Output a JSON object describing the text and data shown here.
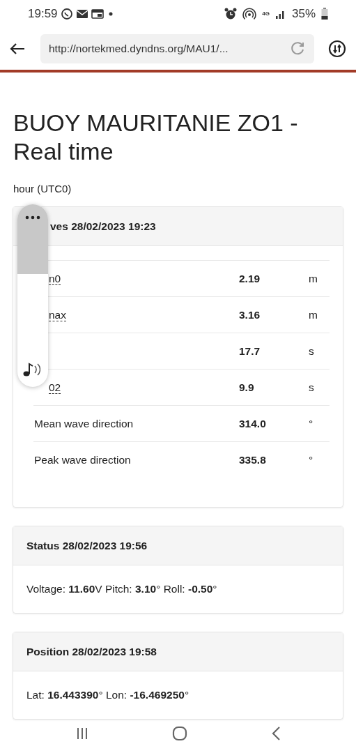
{
  "status_bar": {
    "time": "19:59",
    "network": "4G",
    "battery": "35%"
  },
  "browser": {
    "url": "http://nortekmed.dyndns.org/MAU1/..."
  },
  "page": {
    "title": "BUOY MAURITANIE ZO1 - Real time",
    "subtitle": "hour (UTC0)"
  },
  "waves_card": {
    "header": "ves 28/02/2023 19:23",
    "rows": [
      {
        "label": "n0",
        "covered": true,
        "value": "2.19",
        "unit": "m"
      },
      {
        "label": "nax",
        "covered": true,
        "value": "3.16",
        "unit": "m"
      },
      {
        "covered": true,
        "value": "17.7",
        "unit": "s"
      },
      {
        "label": "02",
        "covered": true,
        "value": "9.9",
        "unit": "s"
      },
      {
        "label": "Mean wave direction",
        "covered": false,
        "value": "314.0",
        "unit": "°"
      },
      {
        "label": "Peak wave direction",
        "covered": false,
        "value": "335.8",
        "unit": "°"
      }
    ]
  },
  "cards": [
    {
      "header": "Status 28/02/2023 19:56",
      "body": "Voltage: **11.60**V Pitch: **3.10**° Roll: **-0.50**°"
    },
    {
      "header": "Position 28/02/2023 19:58",
      "body": "Lat: **16.443390**° Lon: **-16.469250**°"
    }
  ],
  "overlay": {
    "level": 0.38
  }
}
